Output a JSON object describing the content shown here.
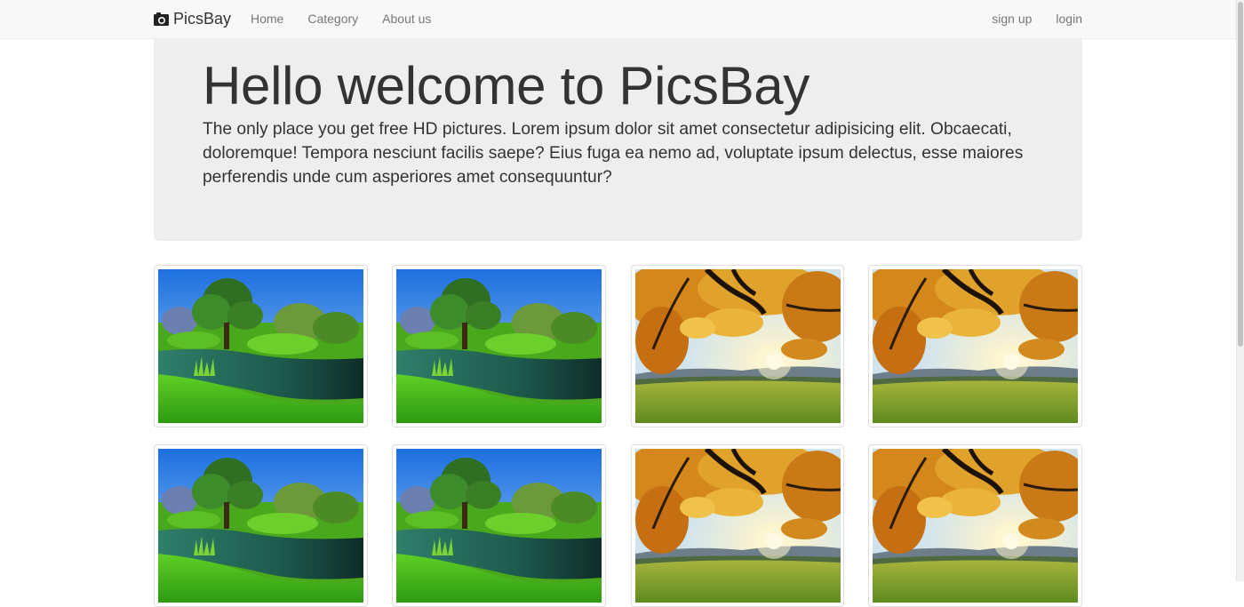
{
  "navbar": {
    "brand": "PicsBay",
    "brand_icon": "camera-icon",
    "links": [
      "Home",
      "Category",
      "About us"
    ],
    "right_links": [
      "sign up",
      "login"
    ]
  },
  "jumbotron": {
    "title": "Hello welcome to PicsBay",
    "text": "The only place you get free HD pictures. Lorem ipsum dolor sit amet consectetur adipisicing elit. Obcaecati, doloremque! Tempora nesciunt facilis saepe? Eius fuga ea nemo ad, voluptate ipsum delectus, esse maiores perferendis unde cum asperiores amet consequuntur?"
  },
  "gallery": {
    "images": [
      {
        "name": "green-lake-landscape"
      },
      {
        "name": "green-lake-landscape"
      },
      {
        "name": "autumn-tree-sunset"
      },
      {
        "name": "autumn-tree-sunset"
      },
      {
        "name": "green-lake-landscape"
      },
      {
        "name": "green-lake-landscape"
      },
      {
        "name": "autumn-tree-sunset"
      },
      {
        "name": "autumn-tree-sunset"
      }
    ]
  },
  "colors": {
    "navbar_bg": "#f8f8f8",
    "jumbotron_bg": "#eeeeee",
    "link": "#777777"
  }
}
